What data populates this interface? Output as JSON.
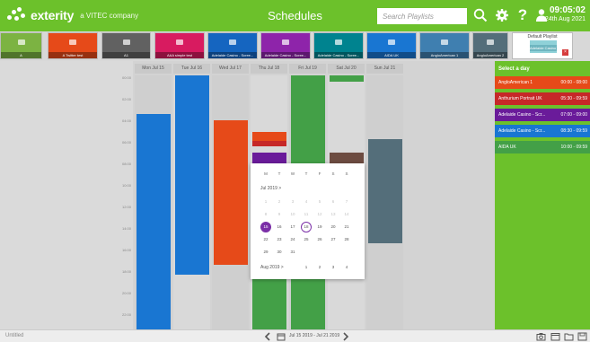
{
  "header": {
    "brand": "exterity",
    "company": "a VITEC company",
    "title": "Schedules",
    "search_placeholder": "Search Playlists",
    "time": "09:05:02",
    "date": "24th Aug 2021",
    "accent": "#6cc12b"
  },
  "playlists": [
    {
      "label": "A",
      "color": "#7cb342"
    },
    {
      "label": "A Twitter test",
      "color": "#e64a19"
    },
    {
      "label": "A1",
      "color": "#616161"
    },
    {
      "label": "AAA simple test",
      "color": "#d81b60"
    },
    {
      "label": "Adelaide Casino - Scree...",
      "color": "#1565c0"
    },
    {
      "label": "Adelaide Casino - Scree...",
      "color": "#8e24aa"
    },
    {
      "label": "Adelaide Casino - Scree...",
      "color": "#00838f"
    },
    {
      "label": "AIDA UK",
      "color": "#1976d2"
    },
    {
      "label": "AngloAmerican 1",
      "color": "#3f7fb0"
    },
    {
      "label": "AngloAmerican 2",
      "color": "#546e7a"
    }
  ],
  "default_playlist": {
    "label": "Default Playlist",
    "sub": "Adelaide Casino - Scre..."
  },
  "calendar": {
    "days": [
      "Mon Jul 15",
      "Tue Jul 16",
      "Wed Jul 17",
      "Thu Jul 18",
      "Fri Jul 19",
      "Sat Jul 20",
      "Sun Jul 21"
    ],
    "times": [
      "00:00",
      "02:00",
      "04:00",
      "06:00",
      "08:00",
      "10:00",
      "12:00",
      "14:00",
      "16:00",
      "18:00",
      "20:00",
      "22:00"
    ]
  },
  "picker": {
    "dow": [
      "M",
      "T",
      "W",
      "T",
      "F",
      "S",
      "S"
    ],
    "month1": "Jul 2019 >",
    "month2": "Aug 2019 >",
    "rows": [
      [
        "1",
        "2",
        "3",
        "4",
        "5",
        "6",
        "7"
      ],
      [
        "8",
        "9",
        "10",
        "11",
        "12",
        "13",
        "14"
      ],
      [
        "15",
        "16",
        "17",
        "18",
        "19",
        "20",
        "21"
      ],
      [
        "22",
        "23",
        "24",
        "25",
        "26",
        "27",
        "28"
      ],
      [
        "29",
        "30",
        "31",
        "",
        "",
        "",
        ""
      ]
    ],
    "aug_row": [
      "1",
      "2",
      "3",
      "4"
    ],
    "selected": "15",
    "today": "18"
  },
  "daypanel": {
    "header": "Select a day",
    "items": [
      {
        "label": "AngloAmerican 1",
        "time": "00:00 - 08:00",
        "color": "#e64a19"
      },
      {
        "label": "Anthurium Portrait UK",
        "time": "05:30 - 09:59",
        "color": "#c62828"
      },
      {
        "label": "Adelaide Casino - Scr...",
        "time": "07:00 - 09:00",
        "color": "#6a1b9a"
      },
      {
        "label": "Adelaide Casino - Scr...",
        "time": "08:30 - 09:59",
        "color": "#1976d2"
      },
      {
        "label": "AIDA UK",
        "time": "10:00 - 09:59",
        "color": "#43a047"
      }
    ]
  },
  "footer": {
    "untitled": "Untitled",
    "range": "Jul 15 2019 - Jul 21 2019"
  }
}
